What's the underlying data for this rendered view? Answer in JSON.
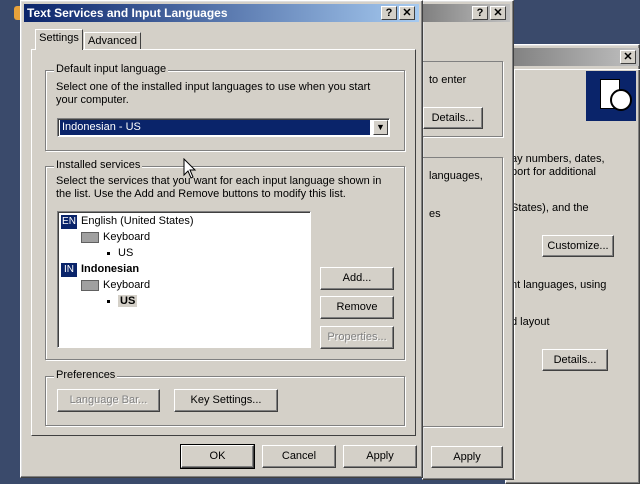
{
  "dialog": {
    "title": "Text Services and Input Languages",
    "help_glyph": "?",
    "close_glyph": "✕",
    "tabs": [
      {
        "label": "Settings"
      },
      {
        "label": "Advanced"
      }
    ],
    "default_input": {
      "group_label": "Default input language",
      "description": "Select one of the installed input languages to use when you start your computer.",
      "selected": "Indonesian - US"
    },
    "installed": {
      "group_label": "Installed services",
      "description": "Select the services that you want for each input language shown in the list. Use the Add and Remove buttons to modify this list.",
      "tree": [
        {
          "code": "EN",
          "label": "English (United States)"
        },
        {
          "label": "Keyboard"
        },
        {
          "label": "US"
        },
        {
          "code": "IN",
          "label": "Indonesian"
        },
        {
          "label": "Keyboard"
        },
        {
          "label": "US"
        }
      ],
      "add_label": "Add...",
      "remove_label": "Remove",
      "properties_label": "Properties..."
    },
    "preferences": {
      "group_label": "Preferences",
      "language_bar_label": "Language Bar...",
      "key_settings_label": "Key Settings..."
    },
    "ok_label": "OK",
    "cancel_label": "Cancel",
    "apply_label": "Apply"
  },
  "background": {
    "middle": {
      "fragments": [
        "to enter",
        "Details...",
        "languages,",
        "es"
      ],
      "apply_label": "Apply",
      "help_glyph": "?",
      "close_glyph": "✕"
    },
    "right": {
      "close_glyph": "✕",
      "fragments": [
        "ay numbers, dates,",
        "port for additional",
        "States), and the",
        "nt languages, using",
        "d layout"
      ],
      "customize_label": "Customize...",
      "details_label": "Details..."
    }
  }
}
